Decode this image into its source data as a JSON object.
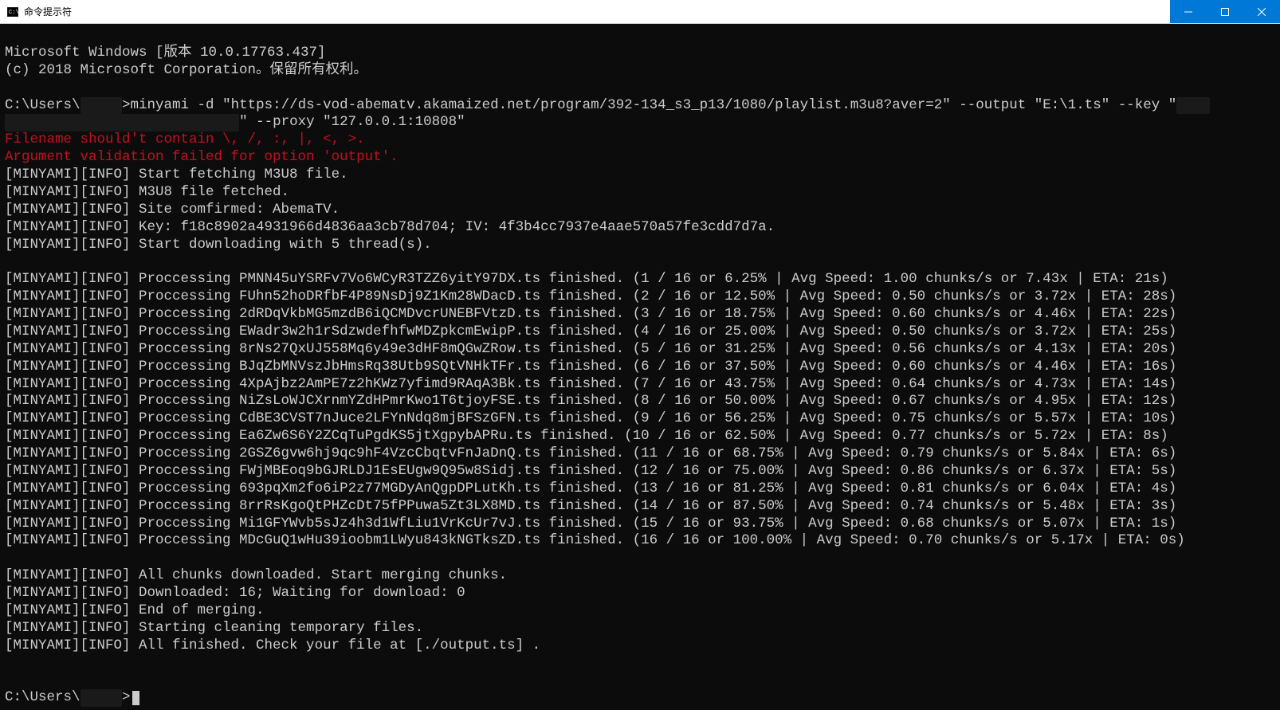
{
  "titlebar": {
    "title": "命令提示符",
    "min": "minimize",
    "max": "maximize",
    "close": "close"
  },
  "header": {
    "ms_line": "Microsoft Windows [版本 10.0.17763.437]",
    "copyright": "(c) 2018 Microsoft Corporation。保留所有权利。"
  },
  "prompt1": "C:\\Users\\",
  "prompt1b": ">",
  "cmd_part1": "minyami -d \"https://ds-vod-abematv.akamaized.net/program/392-134_s3_p13/1080/playlist.m3u8?aver=2\" --output \"E:\\1.ts\" --key \"",
  "cmd_part2": "\" --proxy \"127.0.0.1:10808\"",
  "err1": "Filename should't contain \\, /, :, |, <, >.",
  "err2": "Argument validation failed for option 'output'.",
  "info_lines_pre": [
    "[MINYAMI][INFO] Start fetching M3U8 file.",
    "[MINYAMI][INFO] M3U8 file fetched.",
    "[MINYAMI][INFO] Site comfirmed: AbemaTV.",
    "[MINYAMI][INFO] Key: f18c8902a4931966d4836aa3cb78d704; IV: 4f3b4cc7937e4aae570a57fe3cdd7d7a.",
    "[MINYAMI][INFO] Start downloading with 5 thread(s)."
  ],
  "proc_lines": [
    "[MINYAMI][INFO] Proccessing PMNN45uYSRFv7Vo6WCyR3TZZ6yitY97DX.ts finished. (1 / 16 or 6.25% | Avg Speed: 1.00 chunks/s or 7.43x | ETA: 21s)",
    "[MINYAMI][INFO] Proccessing FUhn52hoDRfbF4P89NsDj9Z1Km28WDacD.ts finished. (2 / 16 or 12.50% | Avg Speed: 0.50 chunks/s or 3.72x | ETA: 28s)",
    "[MINYAMI][INFO] Proccessing 2dRDqVkbMG5mzdB6iQCMDvcrUNEBFVtzD.ts finished. (3 / 16 or 18.75% | Avg Speed: 0.60 chunks/s or 4.46x | ETA: 22s)",
    "[MINYAMI][INFO] Proccessing EWadr3w2h1rSdzwdefhfwMDZpkcmEwipP.ts finished. (4 / 16 or 25.00% | Avg Speed: 0.50 chunks/s or 3.72x | ETA: 25s)",
    "[MINYAMI][INFO] Proccessing 8rNs27QxUJ558Mq6y49e3dHF8mQGwZRow.ts finished. (5 / 16 or 31.25% | Avg Speed: 0.56 chunks/s or 4.13x | ETA: 20s)",
    "[MINYAMI][INFO] Proccessing BJqZbMNVszJbHmsRq38Utb9SQtVNHkTFr.ts finished. (6 / 16 or 37.50% | Avg Speed: 0.60 chunks/s or 4.46x | ETA: 16s)",
    "[MINYAMI][INFO] Proccessing 4XpAjbz2AmPE7z2hKWz7yfimd9RAqA3Bk.ts finished. (7 / 16 or 43.75% | Avg Speed: 0.64 chunks/s or 4.73x | ETA: 14s)",
    "[MINYAMI][INFO] Proccessing NiZsLoWJCXrnmYZdHPmrKwo1T6tjoyFSE.ts finished. (8 / 16 or 50.00% | Avg Speed: 0.67 chunks/s or 4.95x | ETA: 12s)",
    "[MINYAMI][INFO] Proccessing CdBE3CVST7nJuce2LFYnNdq8mjBFSzGFN.ts finished. (9 / 16 or 56.25% | Avg Speed: 0.75 chunks/s or 5.57x | ETA: 10s)",
    "[MINYAMI][INFO] Proccessing Ea6Zw6S6Y2ZCqTuPgdKS5jtXgpybAPRu.ts finished. (10 / 16 or 62.50% | Avg Speed: 0.77 chunks/s or 5.72x | ETA: 8s)",
    "[MINYAMI][INFO] Proccessing 2GSZ6gvw6hj9qc9hF4VzcCbqtvFnJaDnQ.ts finished. (11 / 16 or 68.75% | Avg Speed: 0.79 chunks/s or 5.84x | ETA: 6s)",
    "[MINYAMI][INFO] Proccessing FWjMBEoq9bGJRLDJ1EsEUgw9Q95w8Sidj.ts finished. (12 / 16 or 75.00% | Avg Speed: 0.86 chunks/s or 6.37x | ETA: 5s)",
    "[MINYAMI][INFO] Proccessing 693pqXm2fo6iP2z77MGDyAnQgpDPLutKh.ts finished. (13 / 16 or 81.25% | Avg Speed: 0.81 chunks/s or 6.04x | ETA: 4s)",
    "[MINYAMI][INFO] Proccessing 8rrRsKgoQtPHZcDt75fPPuwa5Zt3LX8MD.ts finished. (14 / 16 or 87.50% | Avg Speed: 0.74 chunks/s or 5.48x | ETA: 3s)",
    "[MINYAMI][INFO] Proccessing Mi1GFYWvb5sJz4h3d1WfLiu1VrKcUr7vJ.ts finished. (15 / 16 or 93.75% | Avg Speed: 0.68 chunks/s or 5.07x | ETA: 1s)",
    "[MINYAMI][INFO] Proccessing MDcGuQ1wHu39ioobm1LWyu843kNGTksZD.ts finished. (16 / 16 or 100.00% | Avg Speed: 0.70 chunks/s or 5.17x | ETA: 0s)"
  ],
  "info_lines_post": [
    "[MINYAMI][INFO] All chunks downloaded. Start merging chunks.",
    "[MINYAMI][INFO] Downloaded: 16; Waiting for download: 0",
    "[MINYAMI][INFO] End of merging.",
    "[MINYAMI][INFO] Starting cleaning temporary files.",
    "[MINYAMI][INFO] All finished. Check your file at [./output.ts] ."
  ],
  "prompt2": "C:\\Users\\",
  "prompt2b": ">"
}
